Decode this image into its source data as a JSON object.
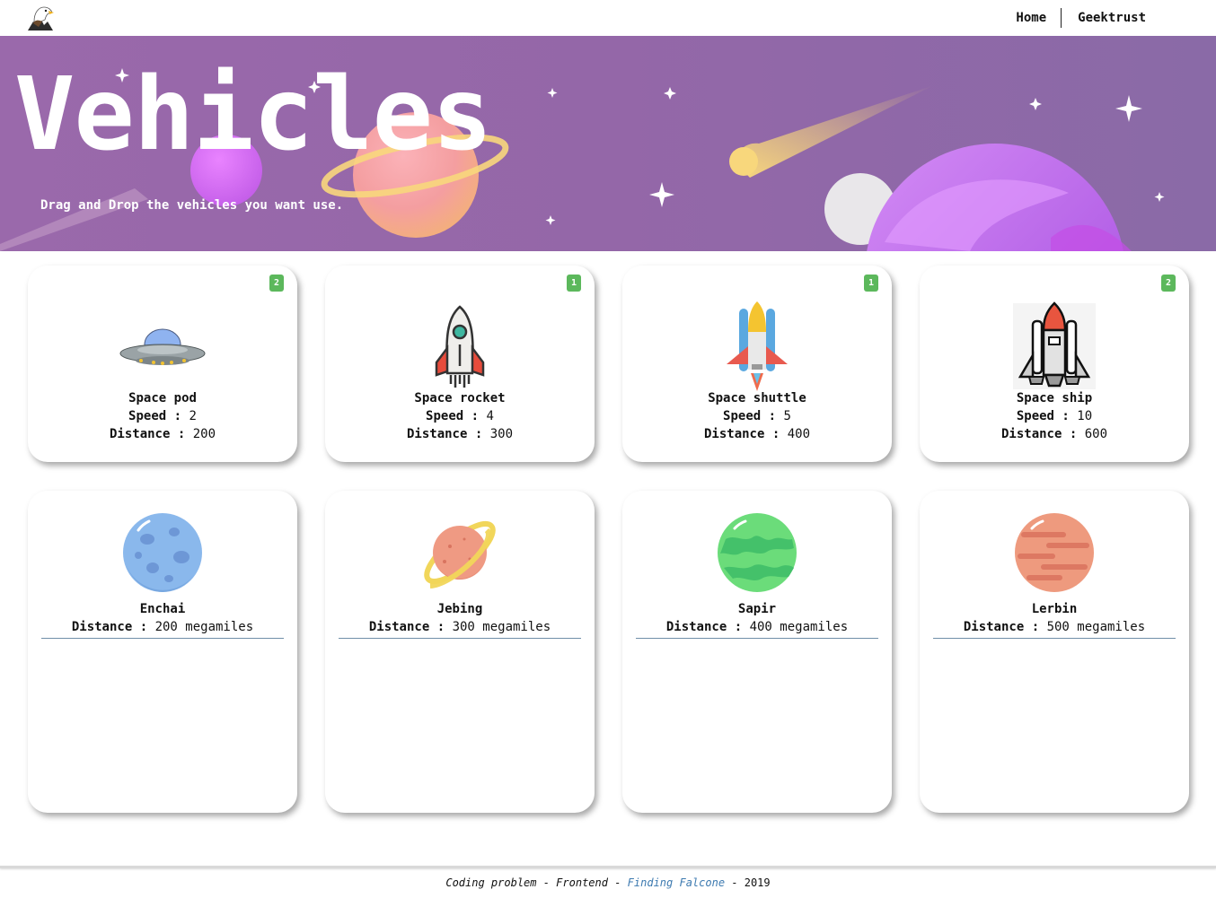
{
  "nav": {
    "home": "Home",
    "geektrust": "Geektrust"
  },
  "hero": {
    "title": "Vehicles",
    "subtitle": "Drag and Drop the vehicles you want use."
  },
  "vehicles": [
    {
      "name": "Space pod",
      "speed_label": "Speed :",
      "speed": "2",
      "distance_label": "Distance :",
      "distance": "200",
      "count": "2",
      "icon": "ufo-icon"
    },
    {
      "name": "Space rocket",
      "speed_label": "Speed :",
      "speed": "4",
      "distance_label": "Distance :",
      "distance": "300",
      "count": "1",
      "icon": "rocket-icon"
    },
    {
      "name": "Space shuttle",
      "speed_label": "Speed :",
      "speed": "5",
      "distance_label": "Distance :",
      "distance": "400",
      "count": "1",
      "icon": "shuttle-icon"
    },
    {
      "name": "Space ship",
      "speed_label": "Speed :",
      "speed": "10",
      "distance_label": "Distance :",
      "distance": "600",
      "count": "2",
      "icon": "space-ship-icon"
    }
  ],
  "planets": [
    {
      "name": "Enchai",
      "distance_label": "Distance :",
      "distance": "200 megamiles",
      "icon": "blue-planet-icon"
    },
    {
      "name": "Jebing",
      "distance_label": "Distance :",
      "distance": "300 megamiles",
      "icon": "ringed-planet-icon"
    },
    {
      "name": "Sapir",
      "distance_label": "Distance :",
      "distance": "400 megamiles",
      "icon": "green-planet-icon"
    },
    {
      "name": "Lerbin",
      "distance_label": "Distance :",
      "distance": "500 megamiles",
      "icon": "red-planet-icon"
    }
  ],
  "footer": {
    "prefix": "Coding problem - Frontend -",
    "link": "Finding Falcone",
    "suffix": "- 2019"
  },
  "colors": {
    "hero": "#9467a8",
    "badge": "#5cb85c",
    "link": "#3d7ab0"
  }
}
